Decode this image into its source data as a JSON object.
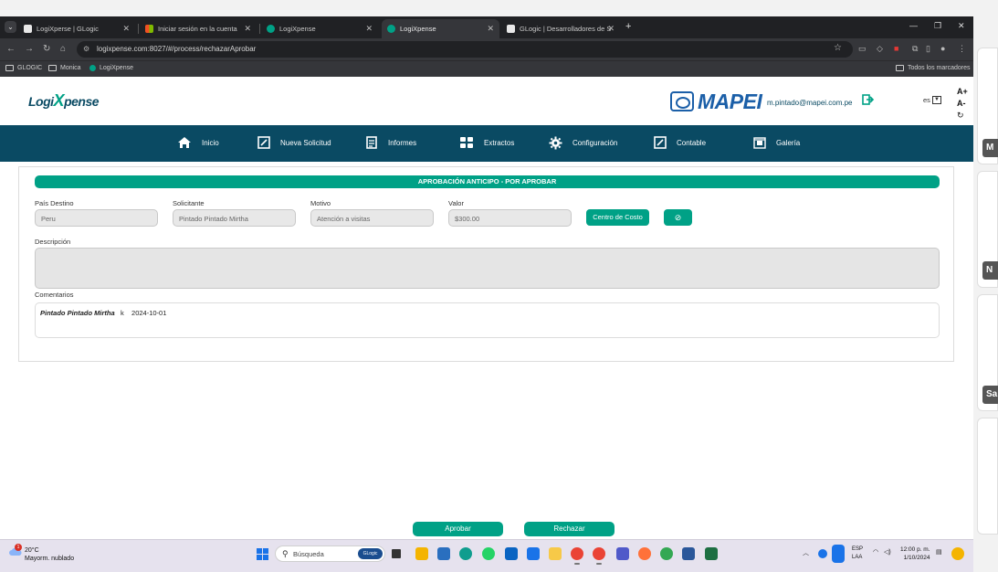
{
  "browser": {
    "tabs": [
      {
        "title": "LogiXperse | GLogic",
        "icon_color": "#e8e8e8",
        "active": false
      },
      {
        "title": "Iniciar sesión en la cuenta",
        "icon_color": "#f25022",
        "active": false
      },
      {
        "title": "LogiXpense",
        "icon_color": "#00a186",
        "active": false
      },
      {
        "title": "LogiXpense",
        "icon_color": "#00a186",
        "active": true
      },
      {
        "title": "GLogic | Desarrolladores de Sof",
        "icon_color": "#e8e8e8",
        "active": false
      }
    ],
    "url": "logixpense.com:8027/#/process/rechazarAprobar",
    "bookmarks": [
      "GLOGIC",
      "Monica",
      "LogiXpense"
    ],
    "all_bookmarks_label": "Todos los marcadores"
  },
  "header": {
    "logo_text_a": "Logi",
    "logo_text_x": "X",
    "logo_text_b": "pense",
    "brand": "MAPEI",
    "user_email": "m.pintado@mapei.com.pe",
    "language": "es",
    "font_increase": "A+",
    "font_decrease": "A-",
    "font_reset": "↻"
  },
  "nav": {
    "items": [
      "Inicio",
      "Nueva Solicitud",
      "Informes",
      "Extractos",
      "Configuración",
      "Contable",
      "Galería"
    ]
  },
  "form": {
    "title": "APROBACIÓN ANTICIPO - POR APROBAR",
    "pais_label": "País Destino",
    "pais_value": "Peru",
    "solicitante_label": "Solicitante",
    "solicitante_value": "Pintado Pintado Mirtha",
    "motivo_label": "Motivo",
    "motivo_value": "Atención a visitas",
    "valor_label": "Valor",
    "valor_value": "$300.00",
    "centro_costo_button": "Centro de Costo",
    "descripcion_label": "Descripción",
    "descripcion_value": "",
    "comentarios_label": "Comentarios",
    "comment_author": "Pintado Pintado Mirtha",
    "comment_text": "k",
    "comment_date": "2024-10-01"
  },
  "actions": {
    "approve": "Aprobar",
    "reject": "Rechazar"
  },
  "side_panel": {
    "badges": [
      "M",
      "N",
      "Sa"
    ]
  },
  "taskbar": {
    "temperature": "20°C",
    "weather": "Mayorm. nublado",
    "weather_alert": "1",
    "search_placeholder": "Búsqueda",
    "search_badge": "GLogic",
    "lang_line1": "ESP",
    "lang_line2": "LAA",
    "time": "12:00 p. m.",
    "date": "1/10/2024"
  },
  "colors": {
    "primary": "#0a4a63",
    "accent": "#00a186",
    "mapei_blue": "#1b5fa8"
  }
}
